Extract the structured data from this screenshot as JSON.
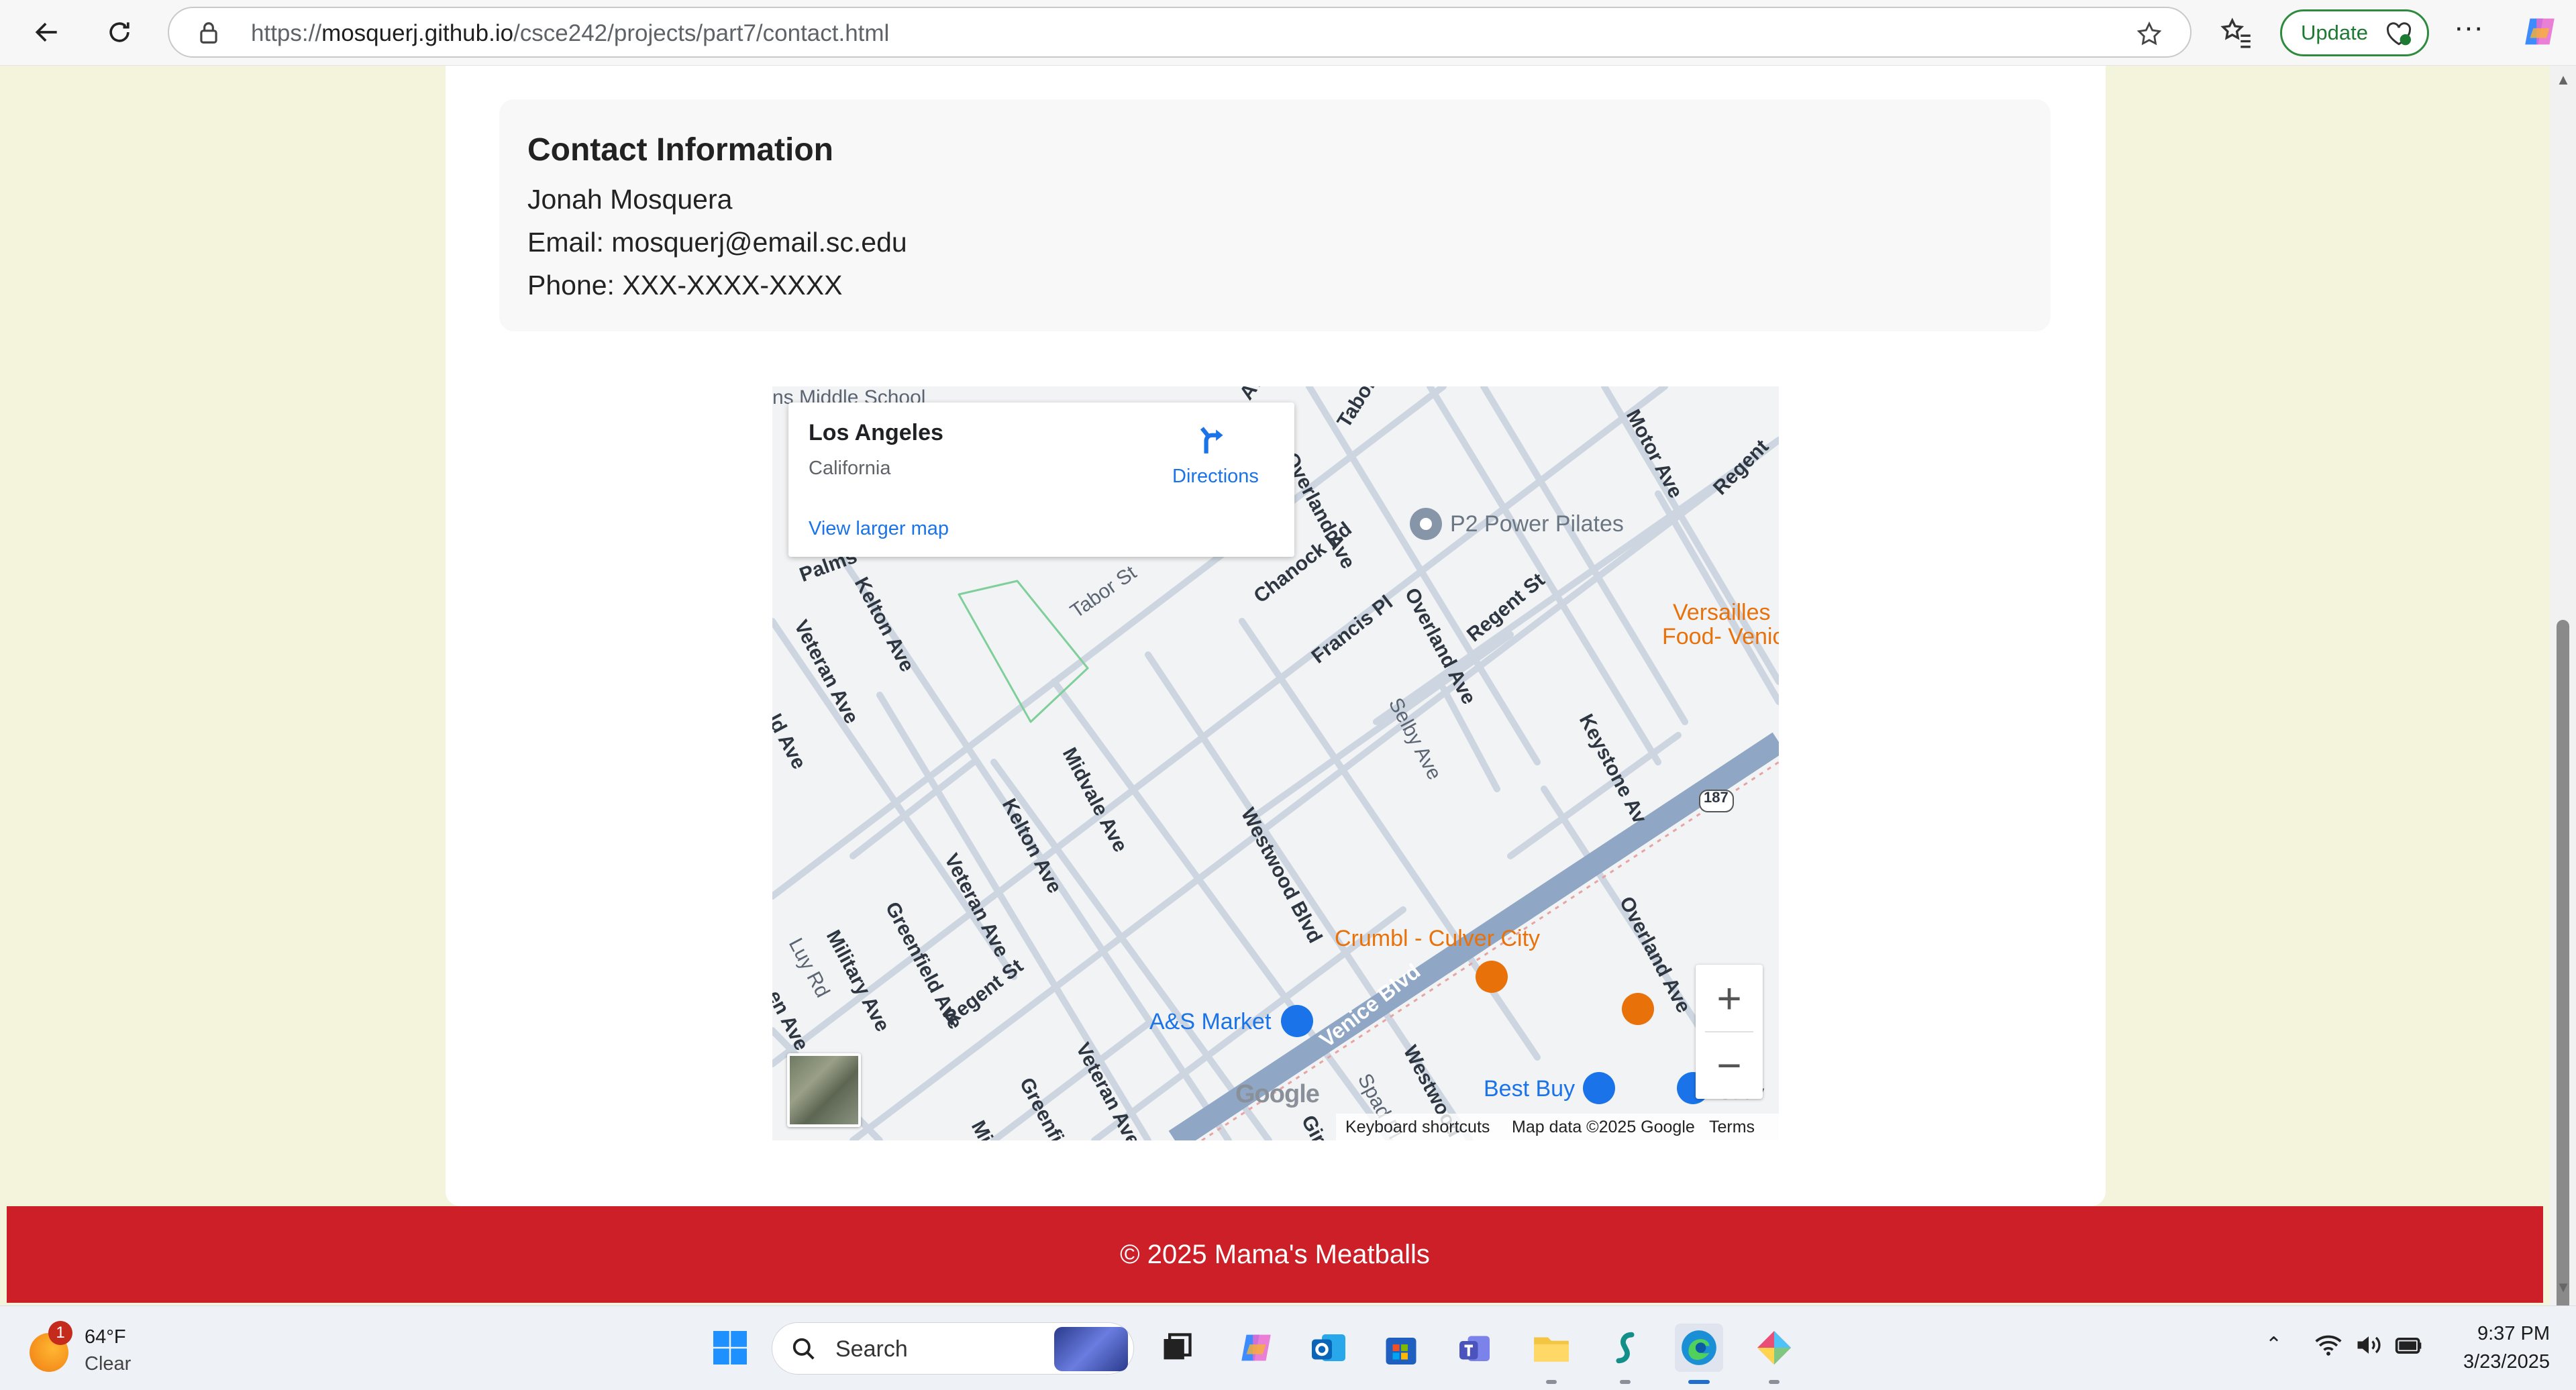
{
  "browser": {
    "url_prefix": "https://",
    "url_host": "mosquerj.github.io",
    "url_path": "/csce242/projects/part7/contact.html",
    "update_label": "Update",
    "more_label": "···"
  },
  "contact": {
    "title": "Contact Information",
    "name": "Jonah Mosquera",
    "email": "Email: mosquerj@email.sc.edu",
    "phone": "Phone: XXX-XXXX-XXXX"
  },
  "map": {
    "place_name": "Los Angeles",
    "place_region": "California",
    "directions_label": "Directions",
    "view_larger_label": "View larger map",
    "zoom_in": "+",
    "zoom_out": "−",
    "logo": "Google",
    "footer": {
      "shortcuts": "Keyboard shortcuts",
      "data": "Map data ©2025 Google",
      "terms": "Terms"
    },
    "labels": {
      "school": "ns Middle School",
      "tabor_top": "Tabor St",
      "overland_top": "Overland Ave",
      "ave_top": "Ave",
      "motor": "Motor Ave",
      "regent_top": "Regent",
      "p2": "P2 Power Pilates",
      "chanock": "Chanock Rd",
      "francis": "Francis Pl",
      "overland_mid": "Overland Ave",
      "regent_mid": "Regent St",
      "versailles_1": "Versailles",
      "versailles_2": "Food- Venic",
      "palms": "Palms",
      "kelton_top": "Kelton Ave",
      "tabor_mid": "Tabor St",
      "veteran_left": "Veteran Ave",
      "ld_ave": "ld Ave",
      "selby": "Selby Ave",
      "keystone": "Keystone Av",
      "midvale": "Midvale Ave",
      "kelton_mid": "Kelton Ave",
      "westwood_mid": "Westwood Blvd",
      "veteran_mid": "Veteran Ave",
      "greenfield_mid": "Greenfield Ave",
      "military": "Military Ave",
      "luy": "Luy Rd",
      "en_ave": "en Ave",
      "regent_low": "Regent St",
      "veteran_low": "Veteran Ave",
      "greenfield_low": "Greenfie",
      "mi": "Mi",
      "crumbl": "Crumbl - Culver City",
      "as_market": "A&S Market",
      "venice": "Venice Blvd",
      "westwood_low": "Westwood",
      "spad": "Spad Pl",
      "giran": "Giran",
      "best_buy": "Best Buy",
      "overland_low": "Overland Ave",
      "hwy": "187",
      "stav": "St av"
    }
  },
  "footer": {
    "text": "© 2025 Mama's Meatballs"
  },
  "taskbar": {
    "weather_temp": "64°F",
    "weather_cond": "Clear",
    "weather_badge": "1",
    "search_label": "Search",
    "time": "9:37 PM",
    "date": "3/23/2025"
  }
}
